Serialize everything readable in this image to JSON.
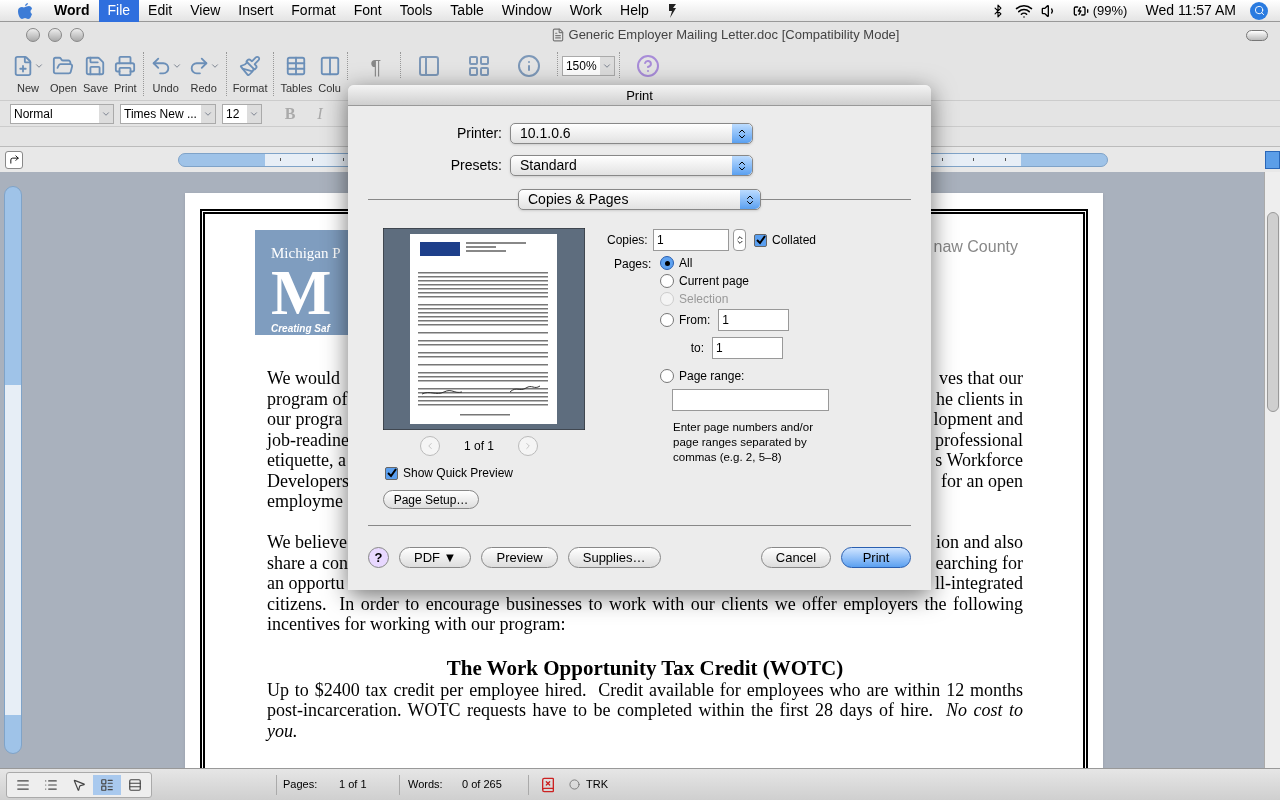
{
  "menu_bar": {
    "app_name": "Word",
    "menus": [
      {
        "label": "File",
        "selected": true
      },
      {
        "label": "Edit",
        "selected": false
      },
      {
        "label": "View",
        "selected": false
      },
      {
        "label": "Insert",
        "selected": false
      },
      {
        "label": "Format",
        "selected": false
      },
      {
        "label": "Font",
        "selected": false
      },
      {
        "label": "Tools",
        "selected": false
      },
      {
        "label": "Table",
        "selected": false
      },
      {
        "label": "Window",
        "selected": false
      },
      {
        "label": "Work",
        "selected": false
      },
      {
        "label": "Help",
        "selected": false
      }
    ],
    "battery": "(99%)",
    "clock": "Wed 11:57 AM"
  },
  "window": {
    "title": "Generic Employer Mailing Letter.doc [Compatibility Mode]"
  },
  "toolbar": {
    "groups": [
      [
        {
          "kind": "button",
          "label": "New",
          "dropdown": true
        },
        {
          "kind": "button",
          "label": "Open",
          "dropdown": false
        },
        {
          "kind": "button",
          "label": "Save",
          "dropdown": false
        },
        {
          "kind": "button",
          "label": "Print",
          "dropdown": false
        }
      ],
      [
        {
          "kind": "button",
          "label": "Undo",
          "dropdown": true
        },
        {
          "kind": "button",
          "label": "Redo",
          "dropdown": true
        }
      ],
      [
        {
          "kind": "button",
          "label": "Format",
          "dropdown": false
        }
      ],
      [
        {
          "kind": "button",
          "label": "Tables",
          "dropdown": false
        },
        {
          "kind": "button",
          "label": "Colu",
          "dropdown": false
        }
      ],
      [
        {
          "kind": "glyph",
          "glyph": "¶"
        }
      ],
      [
        {
          "kind": "icon"
        },
        {
          "kind": "icon"
        },
        {
          "kind": "icon"
        }
      ],
      [
        {
          "kind": "zoom",
          "value": "150%"
        }
      ],
      [
        {
          "kind": "icon"
        }
      ]
    ]
  },
  "format_bar": {
    "style": "Normal",
    "font": "Times New ...",
    "size": "12",
    "buttons": [
      "B",
      "I"
    ]
  },
  "document": {
    "logo": {
      "line1": "Michigan P",
      "letter": "M",
      "tagline": "Creating Saf"
    },
    "header_right": "naw County",
    "paragraph_1": [
      {
        "left": "We would",
        "right": "ves that our"
      },
      {
        "left": "program of",
        "right": "he clients in"
      },
      {
        "left": "our progra",
        "right": "lopment and"
      },
      {
        "left": "job-readine",
        "right": "professional"
      },
      {
        "left": "etiquette, a",
        "right": "s Workforce"
      },
      {
        "left": "Developers",
        "right": "for an open"
      },
      {
        "left": "employme"
      }
    ],
    "paragraph_2": [
      {
        "left": "We believe",
        "right": "ion and also"
      },
      {
        "left": "share a con",
        "right": "earching for"
      },
      {
        "left": "an opportu",
        "right": "ll-integrated"
      }
    ],
    "paragraph_2_end": [
      "citizens.  In order to encourage businesses to work with our clients we offer employers the following",
      "incentives for working with our program:"
    ],
    "heading": "The Work Opportunity Tax Credit (WOTC)",
    "paragraph_3": "Up to $2400 tax credit per employee hired.  Credit available for employees who are within 12 months post-incarceration. WOTC requests have to be completed within the first 28 days of hire.  *No cost to you.*"
  },
  "status_bar": {
    "view_buttons": [
      {
        "selected": false
      },
      {
        "selected": false
      },
      {
        "selected": false
      },
      {
        "selected": true
      },
      {
        "selected": false
      }
    ],
    "pages_label": "Pages:",
    "pages": "1 of 1",
    "words_label": "Words:",
    "words": "0 of 265",
    "track": "TRK"
  },
  "print_dialog": {
    "title": "Print",
    "printer_label": "Printer:",
    "printer": "10.1.0.6",
    "presets_label": "Presets:",
    "presets": "Standard",
    "panel": "Copies & Pages",
    "preview_page": "1 of 1",
    "show_quick_preview": {
      "label": "Show Quick Preview",
      "checked": true
    },
    "page_setup": "Page Setup…",
    "copies_label": "Copies:",
    "copies": "1",
    "collated": {
      "label": "Collated",
      "checked": true
    },
    "pages_label": "Pages:",
    "page_options": [
      {
        "kind": "plain",
        "label": "All",
        "selected": true,
        "disabled": false
      },
      {
        "kind": "plain",
        "label": "Current page",
        "selected": false,
        "disabled": false
      },
      {
        "kind": "plain",
        "label": "Selection",
        "selected": false,
        "disabled": true
      },
      {
        "kind": "from",
        "label": "From:",
        "selected": false,
        "disabled": false
      },
      {
        "kind": "range",
        "label": "Page range:",
        "selected": false,
        "disabled": false
      }
    ],
    "from": "1",
    "to_label": "to:",
    "to": "1",
    "range_hint": "Enter page numbers and/or page ranges separated by commas (e.g. 2, 5–8)",
    "help": "?",
    "left_buttons": [
      {
        "label": "PDF ▼",
        "default": false
      },
      {
        "label": "Preview",
        "default": false
      },
      {
        "label": "Supplies…",
        "default": false
      }
    ],
    "right_buttons": [
      {
        "label": "Cancel",
        "default": false
      },
      {
        "label": "Print",
        "default": true
      }
    ]
  }
}
